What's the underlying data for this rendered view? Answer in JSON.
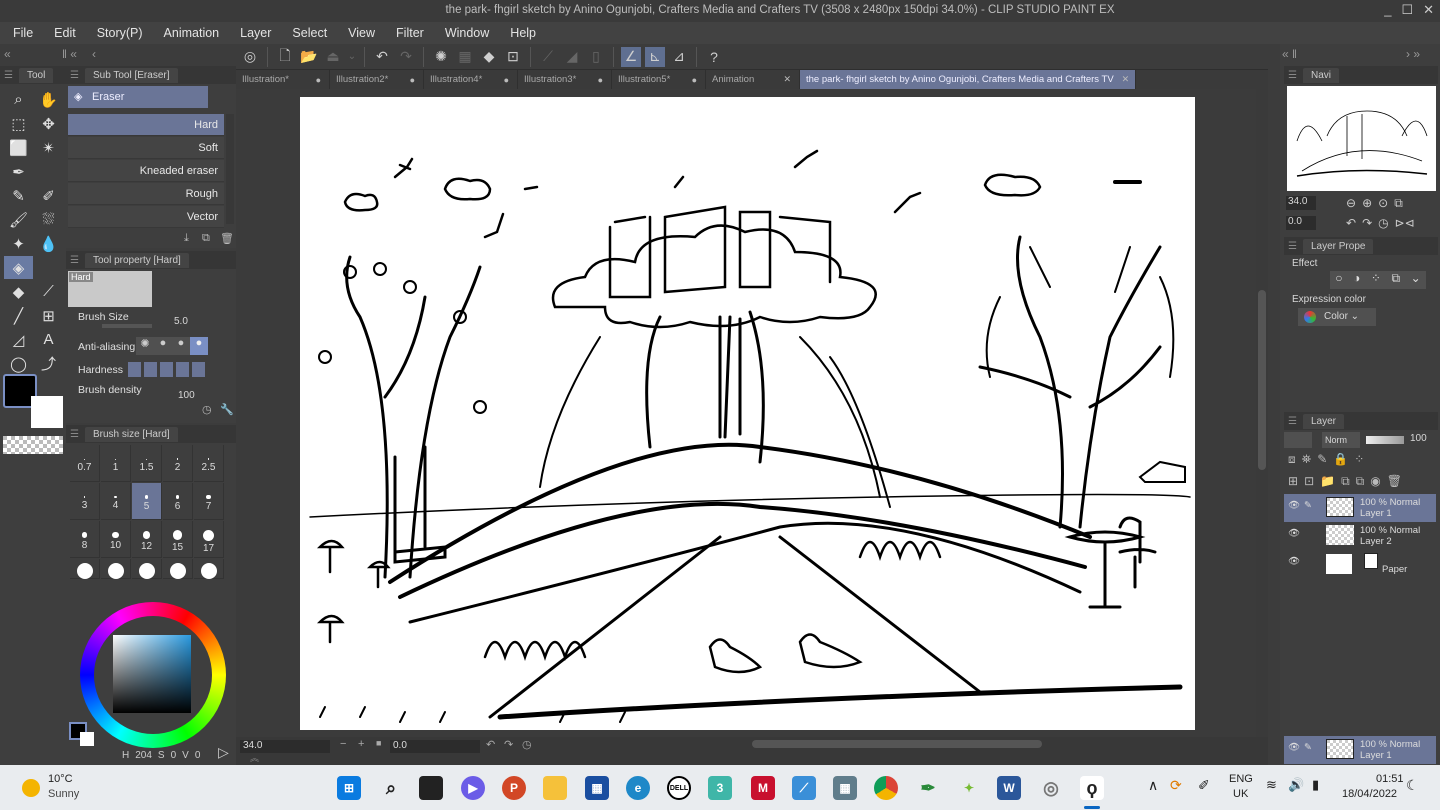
{
  "window": {
    "title": "the park- fhgirl sketch by Anino Ogunjobi, Crafters Media and Crafters TV (3508 x 2480px 150dpi 34.0%)  - CLIP STUDIO PAINT EX",
    "controls": [
      "_",
      "☐",
      "✕"
    ]
  },
  "menu": [
    "File",
    "Edit",
    "Story(P)",
    "Animation",
    "Layer",
    "Select",
    "View",
    "Filter",
    "Window",
    "Help"
  ],
  "tabs": [
    {
      "label": "Illustration*",
      "close": "●"
    },
    {
      "label": "Illustration2*",
      "close": "●"
    },
    {
      "label": "Illustration4*",
      "close": "●"
    },
    {
      "label": "Illustration3*",
      "close": "●"
    },
    {
      "label": "Illustration5*",
      "close": "●"
    },
    {
      "label": "Animation",
      "close": "✕"
    },
    {
      "label": "the park- fhgirl sketch by Anino Ogunjobi, Crafters Media and Crafters TV",
      "close": "✕",
      "active": true
    }
  ],
  "tool_panel": {
    "tab": "Tool"
  },
  "sub_tool": {
    "title": "Sub Tool [Eraser]",
    "group": "Eraser",
    "brushes": [
      "Hard",
      "Soft",
      "Kneaded eraser",
      "Rough",
      "Vector"
    ],
    "selected": "Hard"
  },
  "tool_property": {
    "title": "Tool property [Hard]",
    "preview_label": "Hard",
    "brush_size_label": "Brush Size",
    "brush_size_value": "5.0",
    "anti_aliasing_label": "Anti-aliasing",
    "hardness_label": "Hardness",
    "brush_density_label": "Brush density",
    "brush_density_value": "100"
  },
  "brush_size_panel": {
    "title": "Brush size [Hard]",
    "sizes": [
      "0.7",
      "1",
      "1.5",
      "2",
      "2.5",
      "3",
      "4",
      "5",
      "6",
      "7",
      "8",
      "10",
      "12",
      "15",
      "17"
    ],
    "selected": "5"
  },
  "color": {
    "h_label": "H",
    "h": "204",
    "s_label": "S",
    "s": "0",
    "v_label": "V",
    "v": "0",
    "main": "#000000",
    "sub": "#ffffff"
  },
  "status": {
    "zoom": "34.0",
    "rotation": "0.0"
  },
  "navigator": {
    "tab": "Navi",
    "zoom": "34.0",
    "rotation": "0.0"
  },
  "layer_property": {
    "tab": "Layer Prope",
    "effect_label": "Effect",
    "expression_label": "Expression color",
    "expression_value": "Color"
  },
  "layer_panel": {
    "tab": "Layer",
    "blend": "Norm",
    "opacity": "100",
    "layers": [
      {
        "mode": "100 % Normal",
        "name": "Layer 1",
        "selected": true
      },
      {
        "mode": "100 % Normal",
        "name": "Layer 2",
        "selected": false
      },
      {
        "mode": "",
        "name": "Paper",
        "selected": false
      }
    ],
    "footer_layer": {
      "mode": "100 % Normal",
      "name": "Layer 1"
    }
  },
  "taskbar": {
    "weather_temp": "10°C",
    "weather_desc": "Sunny",
    "lang": "ENG",
    "region": "UK",
    "time": "01:51",
    "date": "18/04/2022"
  }
}
